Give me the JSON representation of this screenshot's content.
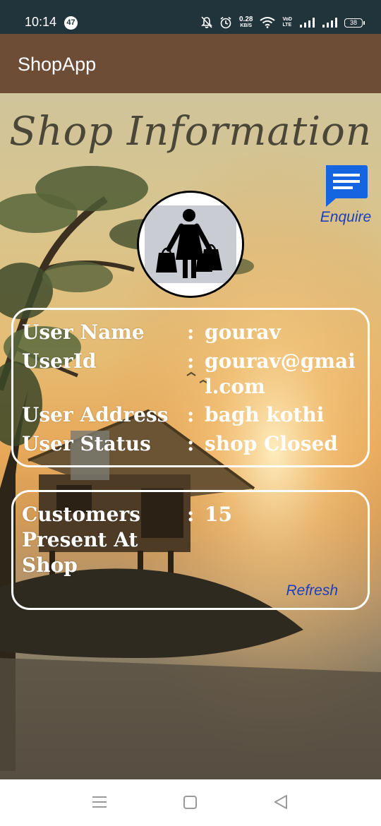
{
  "status_bar": {
    "time": "10:14",
    "notification_count": "47",
    "net_speed": "0.28",
    "net_speed_unit": "KB/S",
    "volte_label_1": "VoD",
    "volte_label_2": "LTE",
    "battery": "38"
  },
  "app_bar": {
    "title": "ShopApp"
  },
  "page": {
    "title": "Shop Information",
    "enquire_label": "Enquire"
  },
  "user_card": {
    "rows": [
      {
        "label": "User Name",
        "separator": ":",
        "value": "gourav"
      },
      {
        "label": "UserId",
        "separator": ":",
        "value": "gourav@gmail.com"
      },
      {
        "label": "User Address",
        "separator": ":",
        "value": "bagh kothi"
      },
      {
        "label": "User Status",
        "separator": ":",
        "value": "shop Closed"
      }
    ]
  },
  "customers_card": {
    "label": "Customers Present At Shop",
    "separator": ":",
    "value": "15",
    "refresh_label": "Refresh"
  },
  "colors": {
    "status_bar": "#22343b",
    "app_bar": "#6e4d37",
    "link_blue": "#1b3fbf",
    "enquire_icon": "#1565e0"
  }
}
